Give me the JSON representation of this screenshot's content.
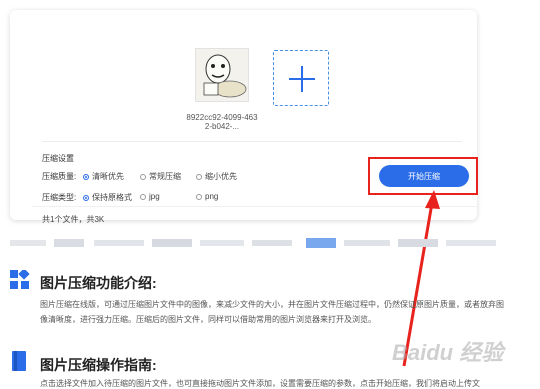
{
  "upload_card": {
    "file": {
      "name": "8922cc92-4099-4632-b042-..."
    },
    "add_icon": "plus-icon",
    "settings": {
      "title": "压缩设置",
      "quality": {
        "label": "压缩质量:",
        "options": [
          "清晰优先",
          "常规压缩",
          "缩小优先"
        ],
        "selected": "清晰优先"
      },
      "type": {
        "label": "压缩类型:",
        "options": [
          "保持原格式",
          "jpg",
          "png"
        ],
        "selected": "保持原格式"
      }
    },
    "start_button": "开始压缩",
    "summary": "共1个文件，共3K"
  },
  "sections": [
    {
      "icon": "grid-icon",
      "title": "图片压缩功能介绍:",
      "text": "图片压缩在线版，可通过压缩图片文件中的图像，来减少文件的大小，并在图片文件压缩过程中，仍然保证原图片质量，或者放弃图像清晰度，进行强力压缩。压缩后的图片文件，同样可以借助常用的图片浏览器来打开及浏览。"
    },
    {
      "icon": "book-icon",
      "title": "图片压缩操作指南:",
      "text": "点击选择文件加入待压缩的图片文件，也可直接拖动图片文件添加，设置需要压缩的参数，点击开始压缩，我们将启动上传文"
    }
  ],
  "colors": {
    "accent": "#2b6de8",
    "highlight": "#e8231d"
  }
}
